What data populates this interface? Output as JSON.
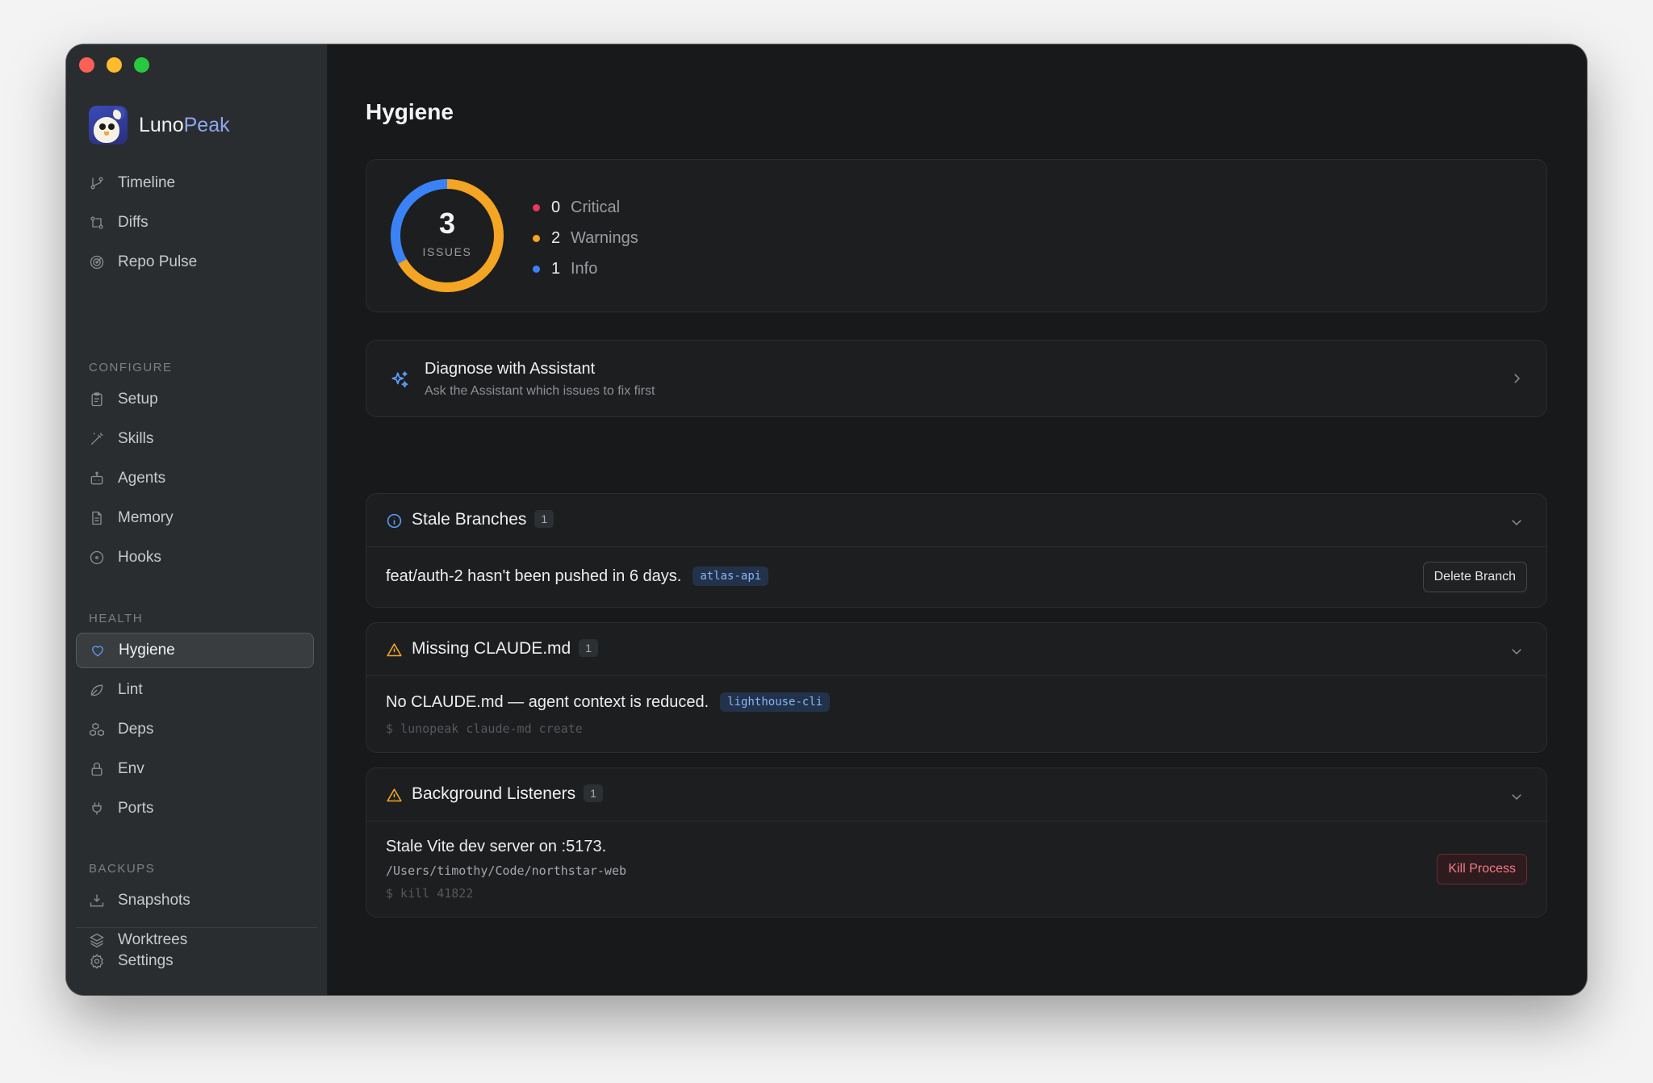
{
  "app": {
    "brand_primary": "Luno",
    "brand_accent": "Peak",
    "colors": {
      "critical": "#e8375a",
      "warning": "#f5a524",
      "info": "#3b82f6",
      "danger": "#f27a86"
    }
  },
  "sidebar": {
    "main_items": [
      {
        "label": "Timeline",
        "icon": "git-branch-icon"
      },
      {
        "label": "Diffs",
        "icon": "git-compare-icon"
      },
      {
        "label": "Repo Pulse",
        "icon": "radar-icon"
      }
    ],
    "configure_label": "CONFIGURE",
    "configure_items": [
      {
        "label": "Setup",
        "icon": "clipboard-icon"
      },
      {
        "label": "Skills",
        "icon": "wand-icon"
      },
      {
        "label": "Agents",
        "icon": "bot-icon"
      },
      {
        "label": "Memory",
        "icon": "file-text-icon"
      },
      {
        "label": "Hooks",
        "icon": "circle-dot-icon"
      }
    ],
    "health_label": "HEALTH",
    "health_items": [
      {
        "label": "Hygiene",
        "icon": "heart-icon",
        "active": true
      },
      {
        "label": "Lint",
        "icon": "leaf-icon"
      },
      {
        "label": "Deps",
        "icon": "boxes-icon"
      },
      {
        "label": "Env",
        "icon": "lock-icon"
      },
      {
        "label": "Ports",
        "icon": "plug-icon"
      }
    ],
    "backups_label": "BACKUPS",
    "backups_items": [
      {
        "label": "Snapshots",
        "icon": "download-tray-icon"
      },
      {
        "label": "Worktrees",
        "icon": "layers-icon"
      }
    ],
    "settings_label": "Settings"
  },
  "main": {
    "title": "Hygiene",
    "summary": {
      "total": "3",
      "total_label": "ISSUES",
      "critical": {
        "count": "0",
        "label": "Critical"
      },
      "warnings": {
        "count": "2",
        "label": "Warnings"
      },
      "info": {
        "count": "1",
        "label": "Info"
      }
    },
    "diagnose": {
      "title": "Diagnose with Assistant",
      "subtitle": "Ask the Assistant which issues to fix first"
    },
    "groups": [
      {
        "title": "Stale Branches",
        "count": "1",
        "severity": "info",
        "message": "feat/auth-2 hasn't been pushed in 6 days.",
        "tag": "atlas-api",
        "action": "Delete Branch"
      },
      {
        "title": "Missing CLAUDE.md",
        "count": "1",
        "severity": "warning",
        "message": "No CLAUDE.md — agent context is reduced.",
        "tag": "lighthouse-cli",
        "command": "$ lunopeak claude-md create"
      },
      {
        "title": "Background Listeners",
        "count": "1",
        "severity": "warning",
        "message": "Stale Vite dev server on :5173.",
        "path": "/Users/timothy/Code/northstar-web",
        "command": "$ kill 41822",
        "action": "Kill Process"
      }
    ]
  }
}
